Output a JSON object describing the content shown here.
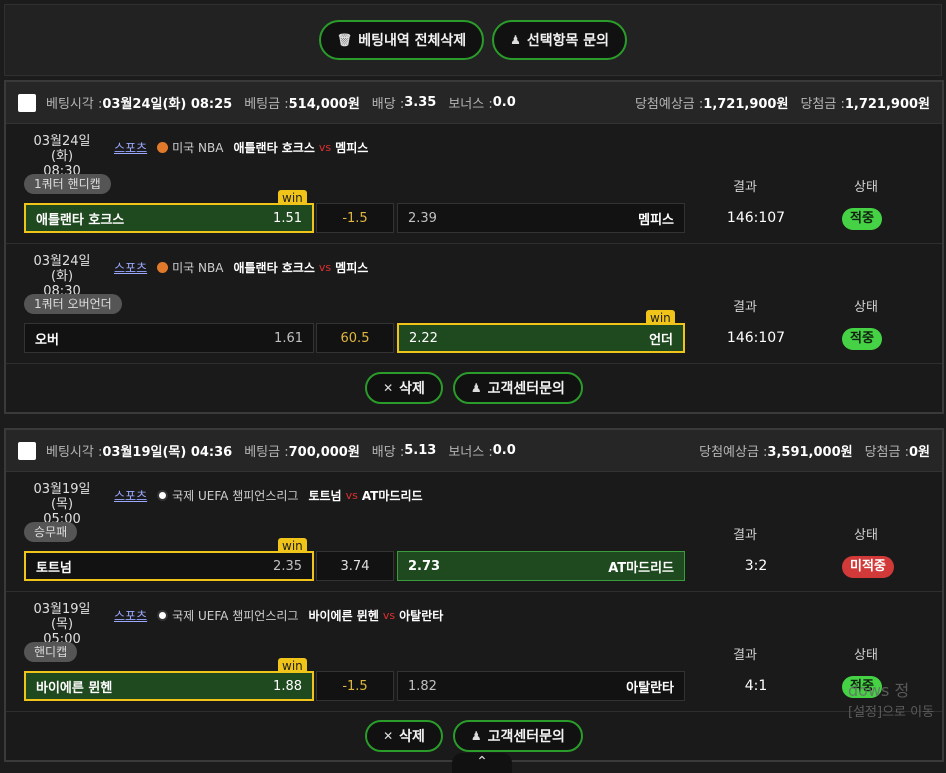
{
  "toolbar": {
    "delete_all_label": "베팅내역 전체삭제",
    "inquiry_label": "선택항목 문의"
  },
  "labels": {
    "bet_time": "베팅시각 :",
    "bet_amount": "베팅금 :",
    "odds": "배당 :",
    "bonus": "보너스 :",
    "expected": "당첨예상금 :",
    "win_amount": "당첨금 :",
    "result": "결과",
    "status": "상태",
    "win_badge": "win",
    "vs": "vs",
    "delete": "삭제",
    "support": "고객센터문의"
  },
  "slips": [
    {
      "time": "03월24일(화) 08:25",
      "amount": "514,000원",
      "odds": "3.35",
      "bonus": "0.0",
      "expected": "1,721,900원",
      "win": "1,721,900원",
      "items": [
        {
          "date": "03월24일(화)",
          "clock": "08:30",
          "category": "스포츠",
          "league": "미국 NBA",
          "home": "애틀랜타 호크스",
          "away": "멤피스",
          "market": "1쿼터 핸디캡",
          "home_label": "애틀랜타 호크스",
          "home_odd": "1.51",
          "line": "-1.5",
          "away_odd": "2.39",
          "away_label": "멤피스",
          "score": "146:107",
          "status": "적중"
        },
        {
          "date": "03월24일(화)",
          "clock": "08:30",
          "category": "스포츠",
          "league": "미국 NBA",
          "home": "애틀랜타 호크스",
          "away": "멤피스",
          "market": "1쿼터 오버언더",
          "home_label": "오버",
          "home_odd": "1.61",
          "line": "60.5",
          "away_odd": "2.22",
          "away_label": "언더",
          "score": "146:107",
          "status": "적중"
        }
      ]
    },
    {
      "time": "03월19일(목) 04:36",
      "amount": "700,000원",
      "odds": "5.13",
      "bonus": "0.0",
      "expected": "3,591,000원",
      "win": "0원",
      "items": [
        {
          "date": "03월19일(목)",
          "clock": "05:00",
          "category": "스포츠",
          "league": "국제 UEFA 챔피언스리그",
          "home": "토트넘",
          "away": "AT마드리드",
          "market": "승무패",
          "home_label": "토트넘",
          "home_odd": "2.35",
          "line": "3.74",
          "away_odd": "2.73",
          "away_label": "AT마드리드",
          "score": "3:2",
          "status": "미적중"
        },
        {
          "date": "03월19일(목)",
          "clock": "05:00",
          "category": "스포츠",
          "league": "국제 UEFA 챔피언스리그",
          "home": "바이에른 뮌헨",
          "away": "아탈란타",
          "market": "핸디캡",
          "home_label": "바이에른 뮌헨",
          "home_odd": "1.88",
          "line": "-1.5",
          "away_odd": "1.82",
          "away_label": "아탈란타",
          "score": "4:1",
          "status": "적중"
        }
      ]
    }
  ],
  "watermark": {
    "line1": "dows 정",
    "line2": "[설정]으로 이동"
  }
}
